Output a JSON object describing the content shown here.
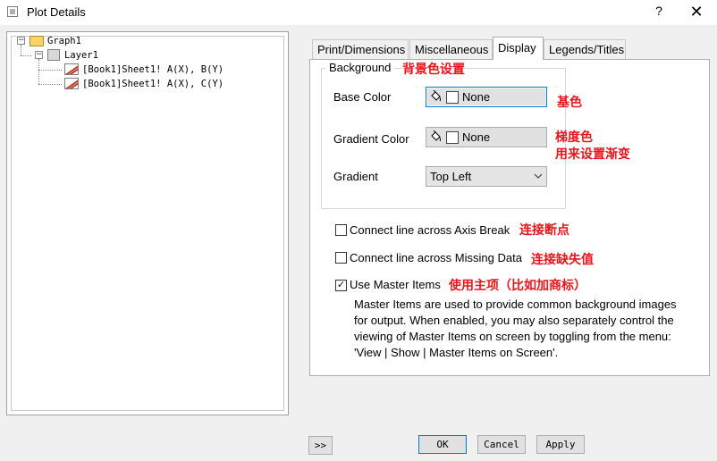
{
  "window": {
    "title": "Plot Details",
    "help_label": "?",
    "close_label": "✕"
  },
  "tree": {
    "graph": {
      "label": "Graph1",
      "expander": "−"
    },
    "layer": {
      "label": "Layer1",
      "expander": "−"
    },
    "plots": [
      {
        "label": "[Book1]Sheet1! A(X), B(Y)"
      },
      {
        "label": "[Book1]Sheet1! A(X), C(Y)"
      }
    ]
  },
  "tabs": [
    {
      "label": "Print/Dimensions",
      "active": false
    },
    {
      "label": "Miscellaneous",
      "active": false
    },
    {
      "label": "Display",
      "active": true
    },
    {
      "label": "Legends/Titles",
      "active": false
    }
  ],
  "background": {
    "group_title": "Background",
    "group_note": "背景色设置",
    "base_color": {
      "label": "Base Color",
      "value": "None",
      "note": "基色"
    },
    "gradient_color": {
      "label": "Gradient Color",
      "value": "None",
      "note_line1": "梯度色",
      "note_line2": "用来设置渐变"
    },
    "gradient": {
      "label": "Gradient",
      "value": "Top Left"
    }
  },
  "options": {
    "connect_axis_break": {
      "label": "Connect line across Axis Break",
      "checked": false,
      "note": "连接断点"
    },
    "connect_missing": {
      "label": "Connect line across Missing Data",
      "checked": false,
      "note": "连接缺失值"
    },
    "use_master": {
      "label": "Use Master Items",
      "checked": true,
      "note": "使用主项（比如加商标）"
    }
  },
  "description": {
    "line1": "Master Items are used to provide common background images",
    "line2": "for output. When enabled, you may also separately control the",
    "line3": "viewing of Master Items on screen by toggling from the menu:",
    "line4": "'View | Show | Master Items on Screen'."
  },
  "footer": {
    "expand_label": ">>",
    "ok_label": "OK",
    "cancel_label": "Cancel",
    "apply_label": "Apply"
  },
  "icons": {
    "bucket": "paint-bucket-icon",
    "check_mark": "✓",
    "dropdown": "⌄"
  },
  "colors": {
    "annotation_red": "#e8151b",
    "focus_blue": "#0078d7"
  }
}
